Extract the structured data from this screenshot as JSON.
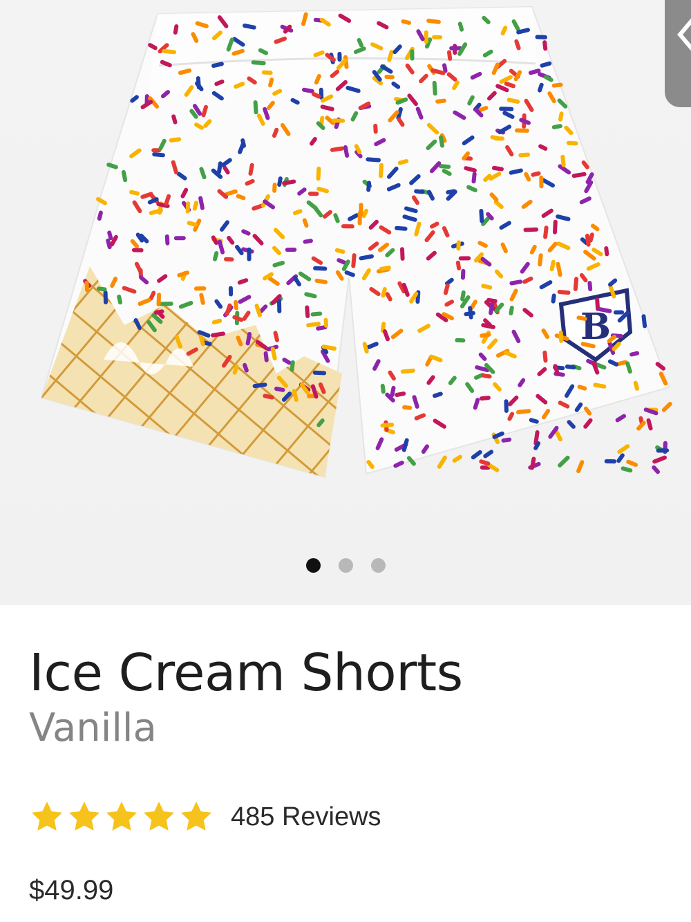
{
  "product": {
    "name": "Ice Cream Shorts",
    "variant": "Vanilla",
    "rating": {
      "stars": 5,
      "max": 5,
      "reviews_label": "485 Reviews"
    },
    "price": "$49.99"
  },
  "gallery": {
    "image_count": 3,
    "active_index": 0,
    "image_icon": "ice-cream-shorts-image"
  },
  "colors": {
    "star": "#f6c31d",
    "active_dot": "#111111",
    "inactive_dot": "#b8b8b8",
    "title": "#1e1e1e",
    "variant": "#858585"
  }
}
